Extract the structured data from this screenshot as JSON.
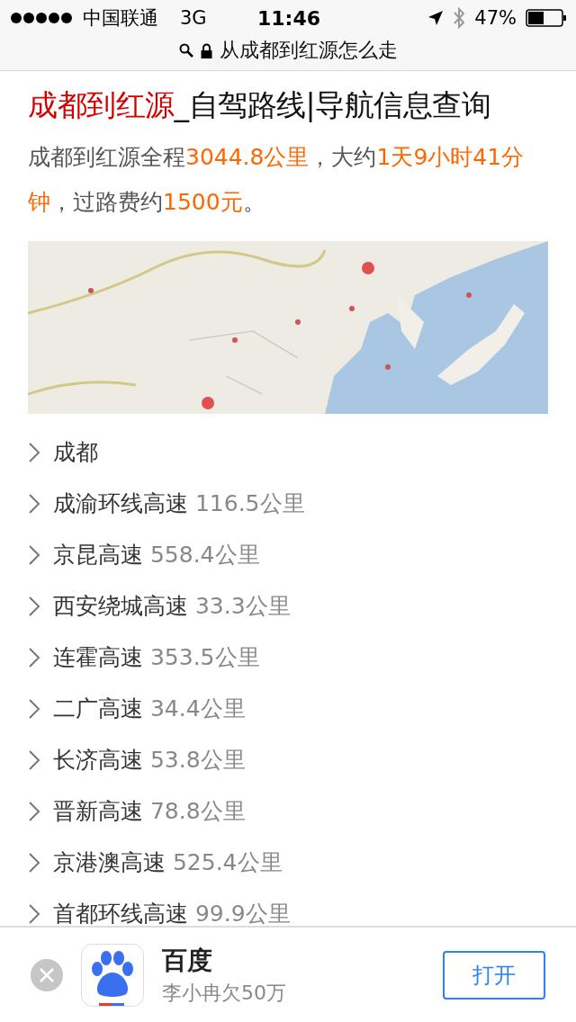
{
  "status_bar": {
    "carrier": "中国联通",
    "network": "3G",
    "time": "11:46",
    "battery": "47%"
  },
  "address_bar": {
    "text": "从成都到红源怎么走",
    "secure": true
  },
  "title": [
    {
      "text": "成都到红源",
      "kind": "highlight"
    },
    {
      "text": "_自驾路线|导航信息查询",
      "kind": "plain"
    }
  ],
  "summary": [
    {
      "text": "成都到红源全程",
      "kind": "plain"
    },
    {
      "text": "3044.8公里",
      "kind": "accent"
    },
    {
      "text": "，大约",
      "kind": "plain"
    },
    {
      "text": "1天9小时41分钟",
      "kind": "accent"
    },
    {
      "text": "，过路费约",
      "kind": "plain"
    },
    {
      "text": "1500元",
      "kind": "accent"
    },
    {
      "text": "。",
      "kind": "plain"
    }
  ],
  "route": [
    {
      "name": "成都"
    },
    {
      "name": "成渝环线高速",
      "distance": "116.5公里"
    },
    {
      "name": "京昆高速",
      "distance": "558.4公里"
    },
    {
      "name": "西安绕城高速",
      "distance": "33.3公里"
    },
    {
      "name": "连霍高速",
      "distance": "353.5公里"
    },
    {
      "name": "二广高速",
      "distance": "34.4公里"
    },
    {
      "name": "长济高速",
      "distance": "53.8公里"
    },
    {
      "name": "晋新高速",
      "distance": "78.8公里"
    },
    {
      "name": "京港澳高速",
      "distance": "525.4公里"
    },
    {
      "name": "首都环线高速",
      "distance": "99.9公里"
    }
  ],
  "app_banner": {
    "name": "百度",
    "subtitle": "李小冉欠50万",
    "open_button": "打开"
  }
}
